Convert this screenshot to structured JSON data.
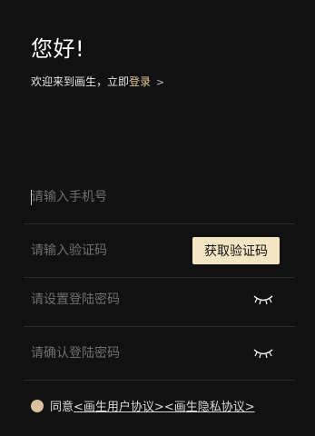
{
  "header": {
    "greeting": "您好!",
    "welcome_prefix": "欢迎来到画生，立即",
    "login_link": "登录",
    "login_chevron": ">"
  },
  "form": {
    "phone_placeholder": "请输入手机号",
    "code_placeholder": "请输入验证码",
    "get_code_button": "获取验证码",
    "password_placeholder": "请设置登陆密码",
    "confirm_password_placeholder": "请确认登陆密码"
  },
  "agreement": {
    "prefix": "同意",
    "user_agreement": "<画生用户协议>",
    "privacy_policy": "<画生隐私协议>"
  },
  "colors": {
    "background": "#111111",
    "accent": "#e2c99a",
    "button_bg": "#f4e5c3",
    "radio": "#d8c29c"
  },
  "icons": {
    "password_toggle": "eye-closed-icon",
    "confirm_password_toggle": "eye-closed-icon"
  }
}
